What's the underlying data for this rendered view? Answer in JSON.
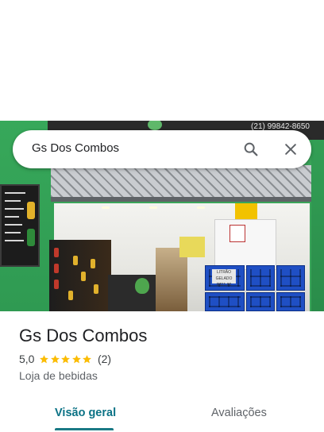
{
  "search": {
    "query": "Gs Dos Combos"
  },
  "photo": {
    "sign_text": "(21) 99842-8650",
    "price_sign_text": "LITRÃO GELADO",
    "price_sign_value": "R$11,00"
  },
  "place": {
    "name": "Gs Dos Combos",
    "rating_value": "5,0",
    "stars": 5,
    "review_count": "(2)",
    "category": "Loja de bebidas"
  },
  "tabs": [
    {
      "label": "Visão geral",
      "active": true
    },
    {
      "label": "Avaliações",
      "active": false
    }
  ],
  "colors": {
    "star": "#fbbc04",
    "active_tab": "#0b7285",
    "tab_indicator": "#1a7a85"
  }
}
